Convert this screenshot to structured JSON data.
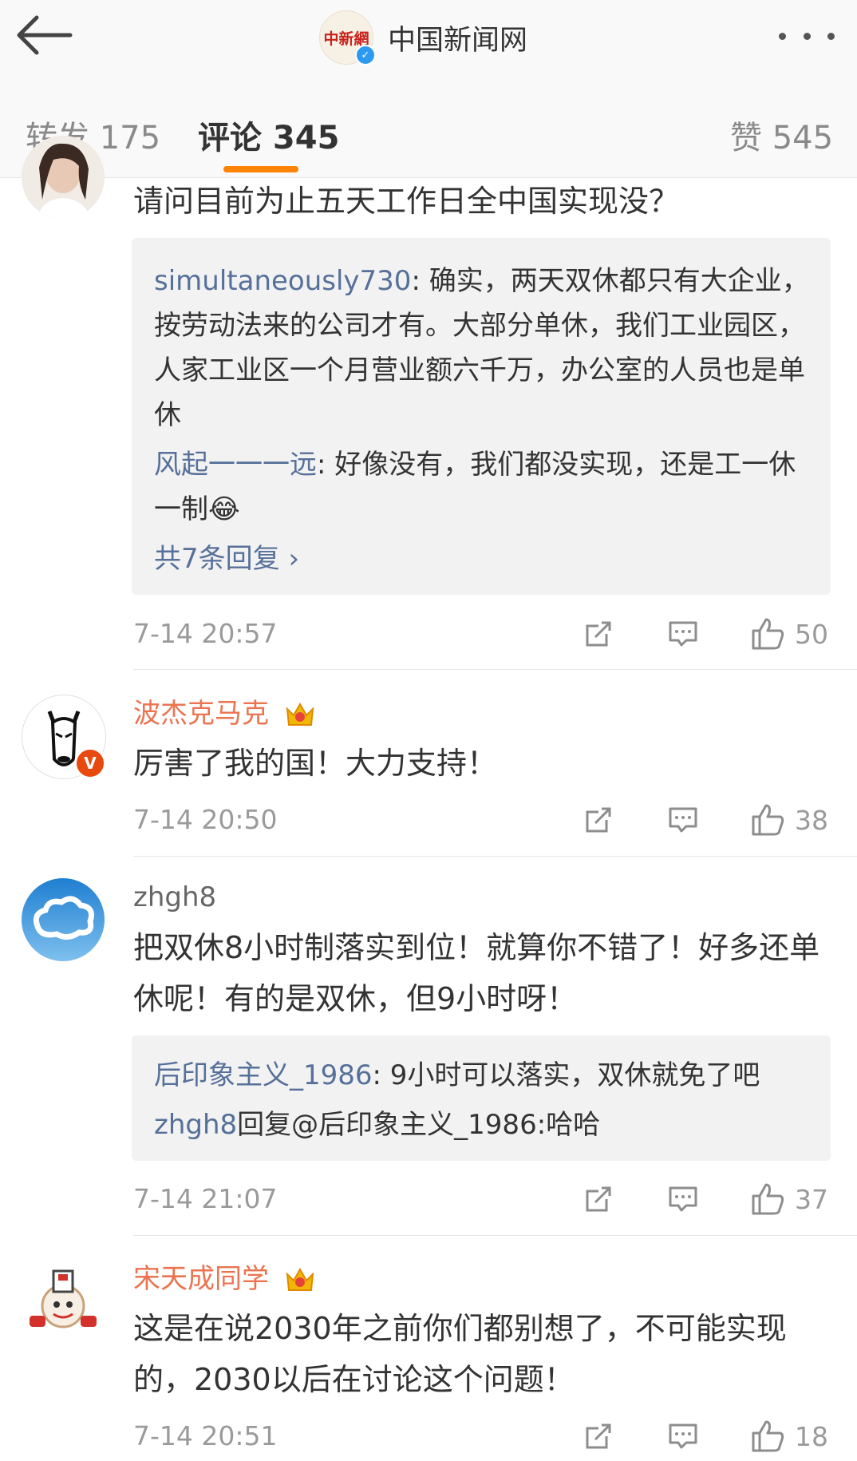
{
  "header": {
    "title": "中国新闻网",
    "logo_text": "中新網"
  },
  "tabs": {
    "repost": "转发 175",
    "comments": "评论 345",
    "likes": "赞 545"
  },
  "comments": [
    {
      "username": "",
      "text": "请问目前为止五天工作日全中国实现没？",
      "replies": [
        {
          "name": "simultaneously730",
          "text": ": 确实，两天双休都只有大企业，按劳动法来的公司才有。大部分单休，我们工业园区，人家工业区一个月营业额六千万，办公室的人员也是单休"
        },
        {
          "name": "风起一一一远",
          "text": ": 好像没有，我们都没实现，还是工一休一制😂"
        }
      ],
      "more_replies": "共7条回复 ›",
      "time": "7-14 20:57",
      "likes": "50"
    },
    {
      "username": "波杰克马克",
      "text": "厉害了我的国！大力支持！",
      "time": "7-14 20:50",
      "likes": "38"
    },
    {
      "username": "zhgh8",
      "text": "把双休8小时制落实到位！就算你不错了！好多还单休呢！有的是双休，但9小时呀！",
      "replies": [
        {
          "name": "后印象主义_1986",
          "text": ": 9小时可以落实，双休就免了吧"
        },
        {
          "name": "zhgh8",
          "text": "回复@后印象主义_1986:哈哈"
        }
      ],
      "time": "7-14 21:07",
      "likes": "37"
    },
    {
      "username": "宋天成同学",
      "text": "这是在说2030年之前你们都别想了，不可能实现的，2030以后在讨论这个问题！",
      "time": "7-14 20:51",
      "likes": "18"
    }
  ],
  "colors": {
    "accent": "#ff8200",
    "vip_name": "#eb7350",
    "link": "#56709a"
  }
}
